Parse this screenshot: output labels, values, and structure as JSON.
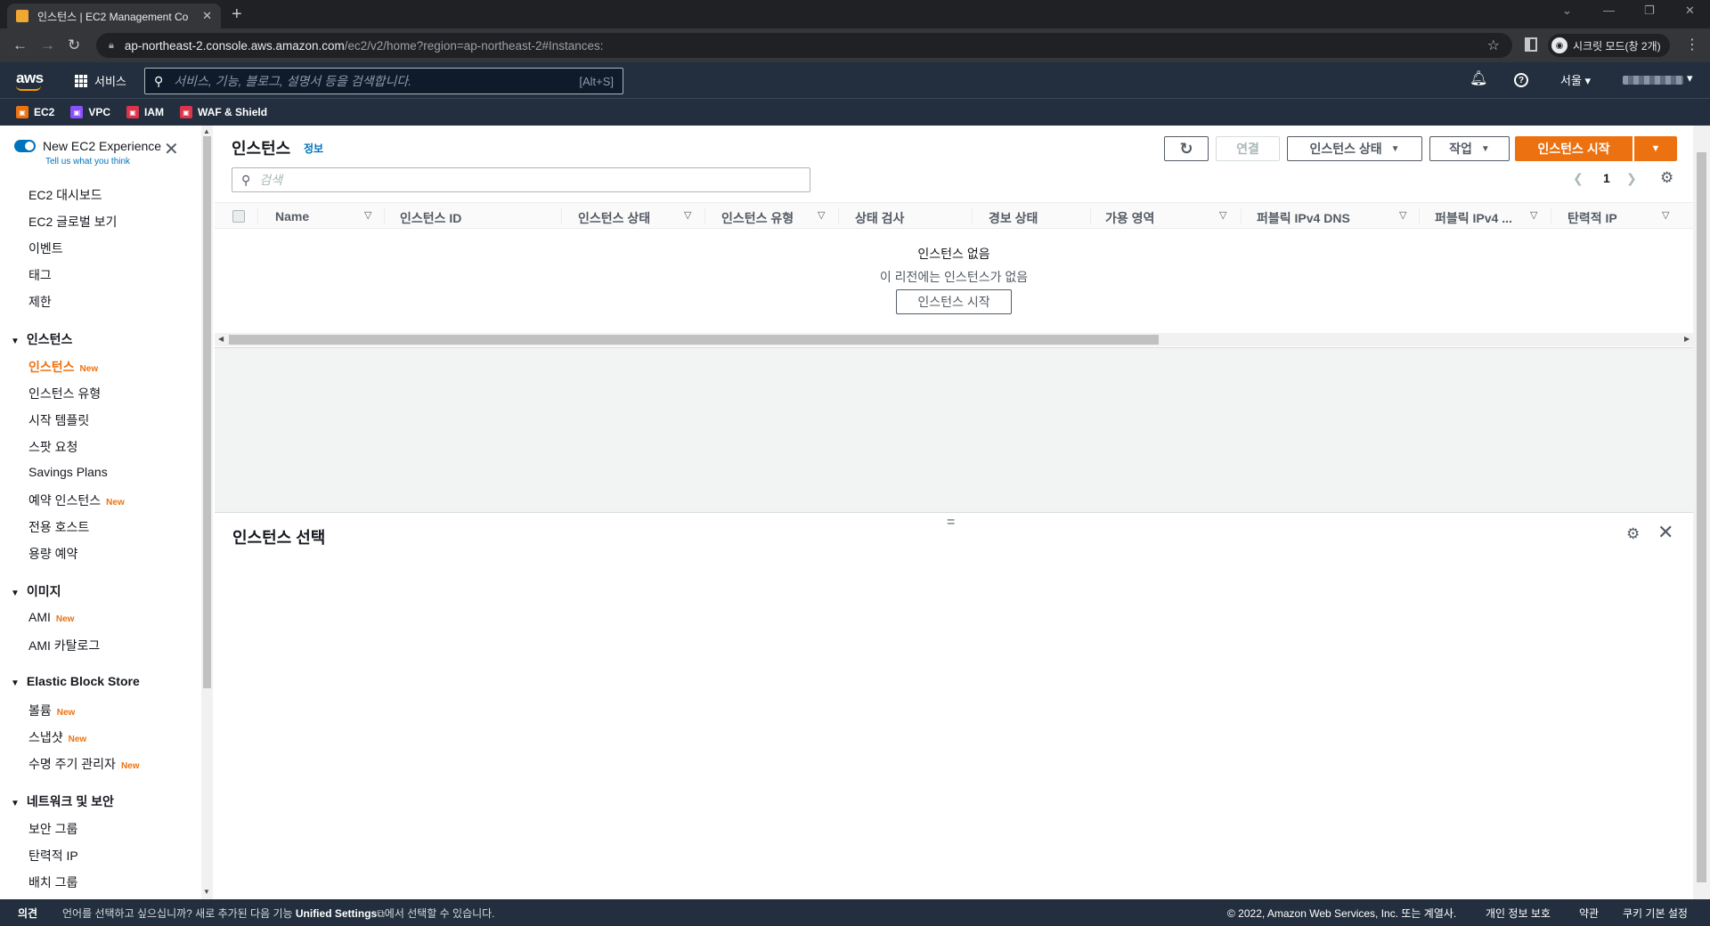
{
  "browser": {
    "tab_title": "인스턴스 | EC2 Management Co",
    "url_host": "ap-northeast-2.console.aws.amazon.com",
    "url_path": "/ec2/v2/home?region=ap-northeast-2#Instances:",
    "incognito_label": "시크릿 모드(창 2개)"
  },
  "aws_header": {
    "logo": "aws",
    "services_label": "서비스",
    "search_placeholder": "서비스, 기능, 블로그, 설명서 등을 검색합니다.",
    "search_shortcut": "[Alt+S]",
    "region": "서울"
  },
  "favorites": [
    {
      "label": "EC2",
      "color": "#ec7211"
    },
    {
      "label": "VPC",
      "color": "#8c4fff"
    },
    {
      "label": "IAM",
      "color": "#dd344c"
    },
    {
      "label": "WAF & Shield",
      "color": "#dd344c"
    }
  ],
  "sidebar": {
    "new_experience": "New EC2 Experience",
    "tell_us": "Tell us what you think",
    "top_items": [
      "EC2 대시보드",
      "EC2 글로벌 보기",
      "이벤트",
      "태그",
      "제한"
    ],
    "sections": [
      {
        "title": "인스턴스",
        "items": [
          {
            "label": "인스턴스",
            "badge": "New",
            "active": true
          },
          {
            "label": "인스턴스 유형",
            "badge": ""
          },
          {
            "label": "시작 템플릿",
            "badge": ""
          },
          {
            "label": "스팟 요청",
            "badge": ""
          },
          {
            "label": "Savings Plans",
            "badge": ""
          },
          {
            "label": "예약 인스턴스",
            "badge": "New"
          },
          {
            "label": "전용 호스트",
            "badge": ""
          },
          {
            "label": "용량 예약",
            "badge": ""
          }
        ]
      },
      {
        "title": "이미지",
        "items": [
          {
            "label": "AMI",
            "badge": "New"
          },
          {
            "label": "AMI 카탈로그",
            "badge": ""
          }
        ]
      },
      {
        "title": "Elastic Block Store",
        "items": [
          {
            "label": "볼륨",
            "badge": "New"
          },
          {
            "label": "스냅샷",
            "badge": "New"
          },
          {
            "label": "수명 주기 관리자",
            "badge": "New"
          }
        ]
      },
      {
        "title": "네트워크 및 보안",
        "items": [
          {
            "label": "보안 그룹",
            "badge": ""
          },
          {
            "label": "탄력적 IP",
            "badge": ""
          },
          {
            "label": "배치 그룹",
            "badge": ""
          }
        ]
      }
    ]
  },
  "instances_panel": {
    "title": "인스턴스",
    "info": "정보",
    "connect": "연결",
    "instance_state": "인스턴스 상태",
    "actions": "작업",
    "launch": "인스턴스 시작",
    "search_placeholder": "검색",
    "page": "1",
    "columns": [
      "Name",
      "인스턴스 ID",
      "인스턴스 상태",
      "인스턴스 유형",
      "상태 검사",
      "경보 상태",
      "가용 영역",
      "퍼블릭 IPv4 DNS",
      "퍼블릭 IPv4 ...",
      "탄력적 IP"
    ],
    "empty_title": "인스턴스 없음",
    "empty_desc": "이 리전에는 인스턴스가 없음",
    "empty_button": "인스턴스 시작"
  },
  "details_panel": {
    "title": "인스턴스 선택"
  },
  "footer": {
    "feedback": "의견",
    "lang_prefix": "언어를 선택하고 싶으십니까? 새로 추가된 다음 기능 ",
    "lang_link": "Unified Settings",
    "lang_suffix": "에서 선택할 수 있습니다.",
    "copyright": "© 2022, Amazon Web Services, Inc. 또는 계열사.",
    "privacy": "개인 정보 보호",
    "terms": "약관",
    "cookies": "쿠키 기본 설정"
  }
}
